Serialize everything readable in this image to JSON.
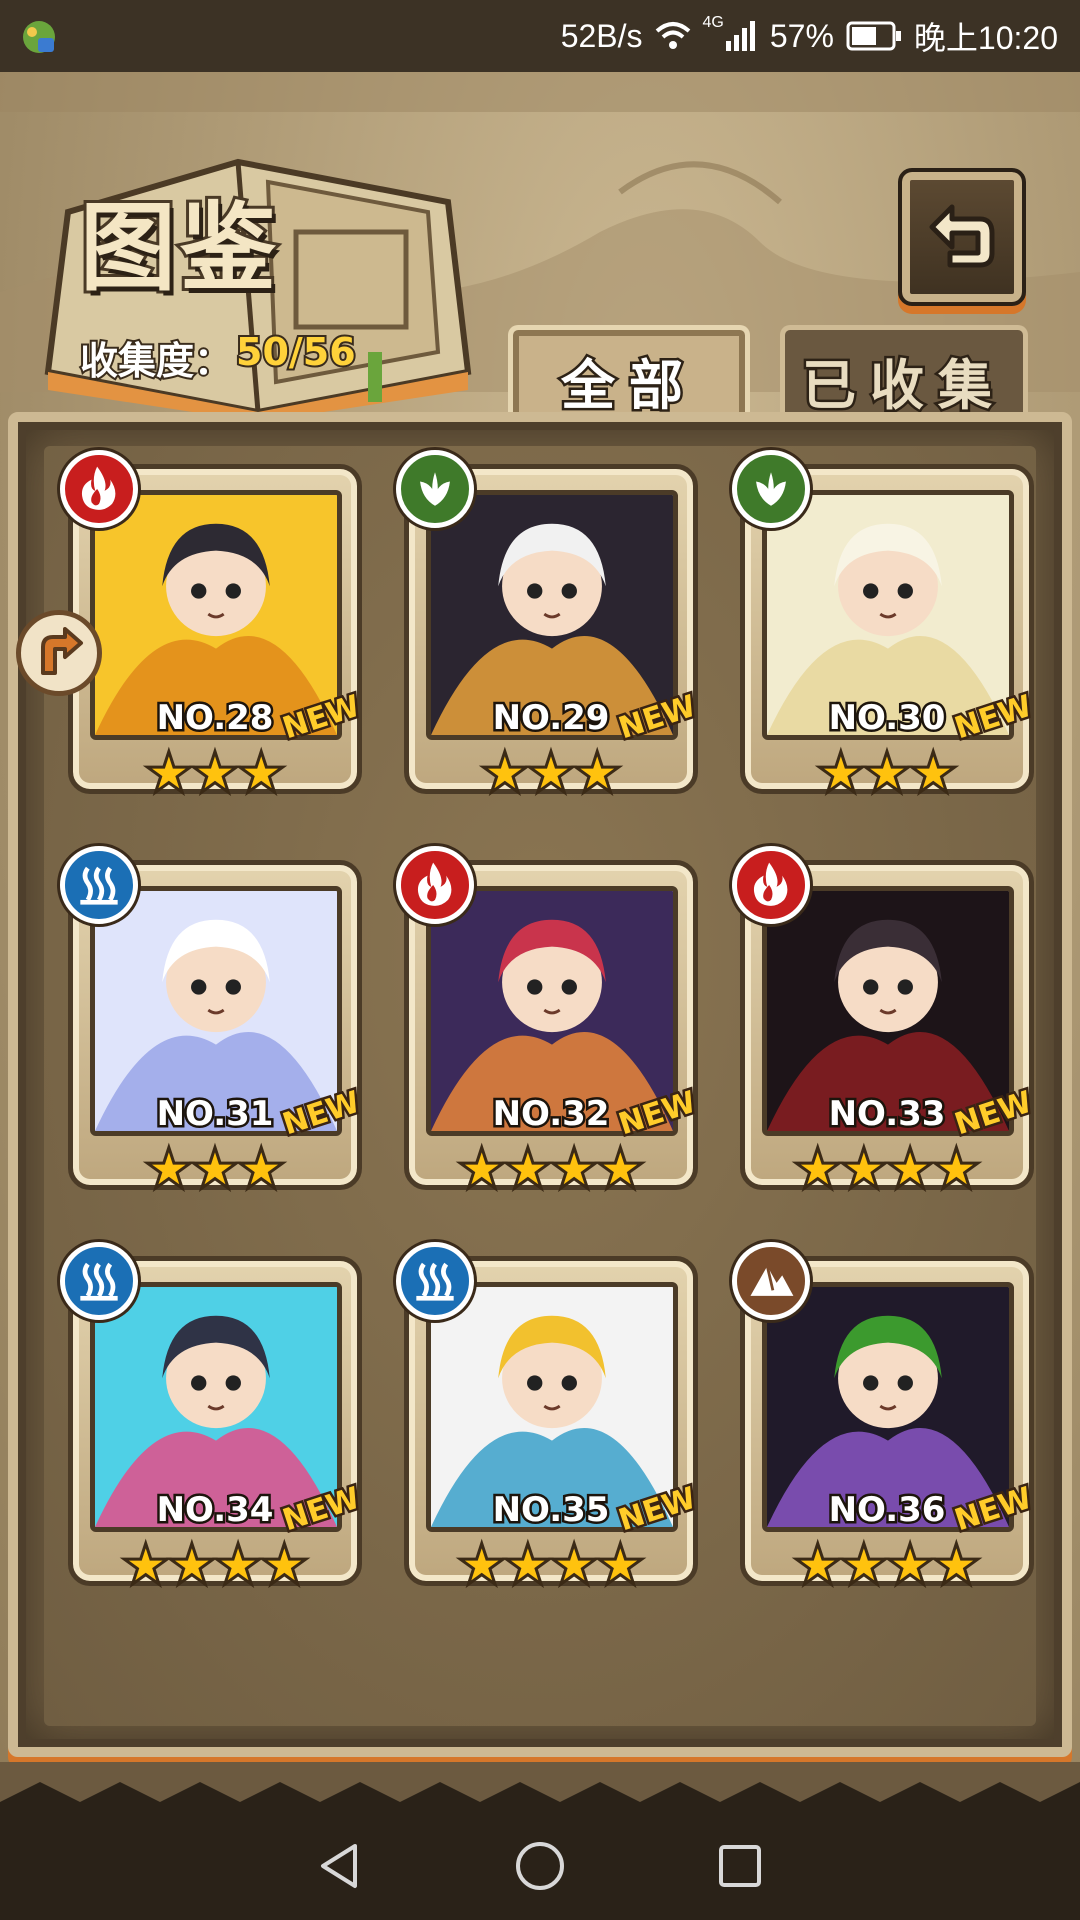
{
  "status_bar": {
    "net_speed": "52B/s",
    "network": "4G",
    "battery": "57%",
    "time": "晚上10:20"
  },
  "header": {
    "title": "图鉴",
    "collect_label": "收集度：",
    "collect_value": "50/56"
  },
  "tabs": [
    {
      "label": "全部",
      "active": true
    },
    {
      "label": "已收集",
      "active": false
    }
  ],
  "new_label": "NEW",
  "cards": [
    {
      "no": "NO.28",
      "element": "fire",
      "stars": 3,
      "new": true
    },
    {
      "no": "NO.29",
      "element": "wood",
      "stars": 3,
      "new": true
    },
    {
      "no": "NO.30",
      "element": "wood",
      "stars": 3,
      "new": true
    },
    {
      "no": "NO.31",
      "element": "water",
      "stars": 3,
      "new": true
    },
    {
      "no": "NO.32",
      "element": "fire",
      "stars": 4,
      "new": true
    },
    {
      "no": "NO.33",
      "element": "fire",
      "stars": 4,
      "new": true
    },
    {
      "no": "NO.34",
      "element": "water",
      "stars": 4,
      "new": true
    },
    {
      "no": "NO.35",
      "element": "water",
      "stars": 4,
      "new": true
    },
    {
      "no": "NO.36",
      "element": "earth",
      "stars": 4,
      "new": true
    }
  ],
  "colors": {
    "fire": "#c81e1e",
    "wood": "#3f7a2a",
    "water": "#1b6fb5",
    "earth": "#7a4a2a",
    "star": "#ffc20e",
    "collect_value": "#ffd23a"
  },
  "icons": {
    "fire": "flame-icon",
    "wood": "leaf-icon",
    "water": "waves-icon",
    "earth": "mountain-icon",
    "back": "return-arrow-icon",
    "side": "turn-arrow-icon"
  }
}
